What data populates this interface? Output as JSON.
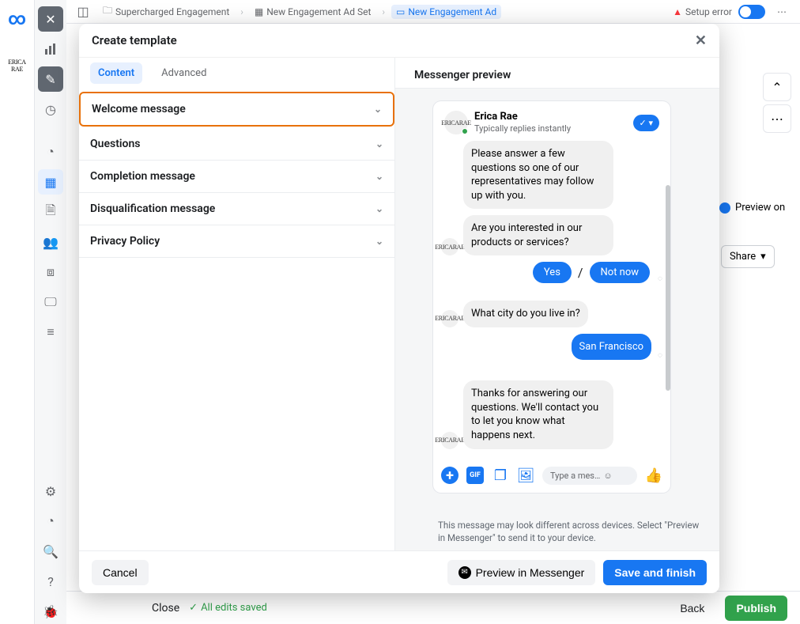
{
  "rail1": {
    "logo_alt": "Meta"
  },
  "topbar": {
    "campaign": "Supercharged Engagement",
    "adset": "New Engagement Ad Set",
    "ad": "New Engagement Ad",
    "setup_error": "Setup error"
  },
  "bg": {
    "preview_on": "Preview on",
    "share": "Share"
  },
  "footer": {
    "close": "Close",
    "saved": "All edits saved",
    "back": "Back",
    "publish": "Publish"
  },
  "modal": {
    "title": "Create template",
    "tabs": {
      "content": "Content",
      "advanced": "Advanced"
    },
    "sections": {
      "welcome": "Welcome message",
      "questions": "Questions",
      "completion": "Completion message",
      "disqualification": "Disqualification message",
      "privacy": "Privacy Policy"
    },
    "preview_title": "Messenger preview",
    "business_name": "Erica Rae",
    "business_sub": "Typically replies instantly",
    "msg_welcome": "Please answer a few questions so one of our representatives may follow up with you.",
    "msg_q1": "Are you interested in our products or services?",
    "reply_yes": "Yes",
    "reply_notnow": "Not now",
    "msg_q2": "What city do you live in?",
    "reply_city": "San Francisco",
    "msg_completion": "Thanks for answering our questions. We'll contact you to let you know what happens next.",
    "composer_placeholder": "Type a mes…",
    "note": "This message may look different across devices. Select \"Preview in Messenger\" to send it to your device.",
    "cancel": "Cancel",
    "preview_btn": "Preview in Messenger",
    "save_btn": "Save and finish"
  }
}
